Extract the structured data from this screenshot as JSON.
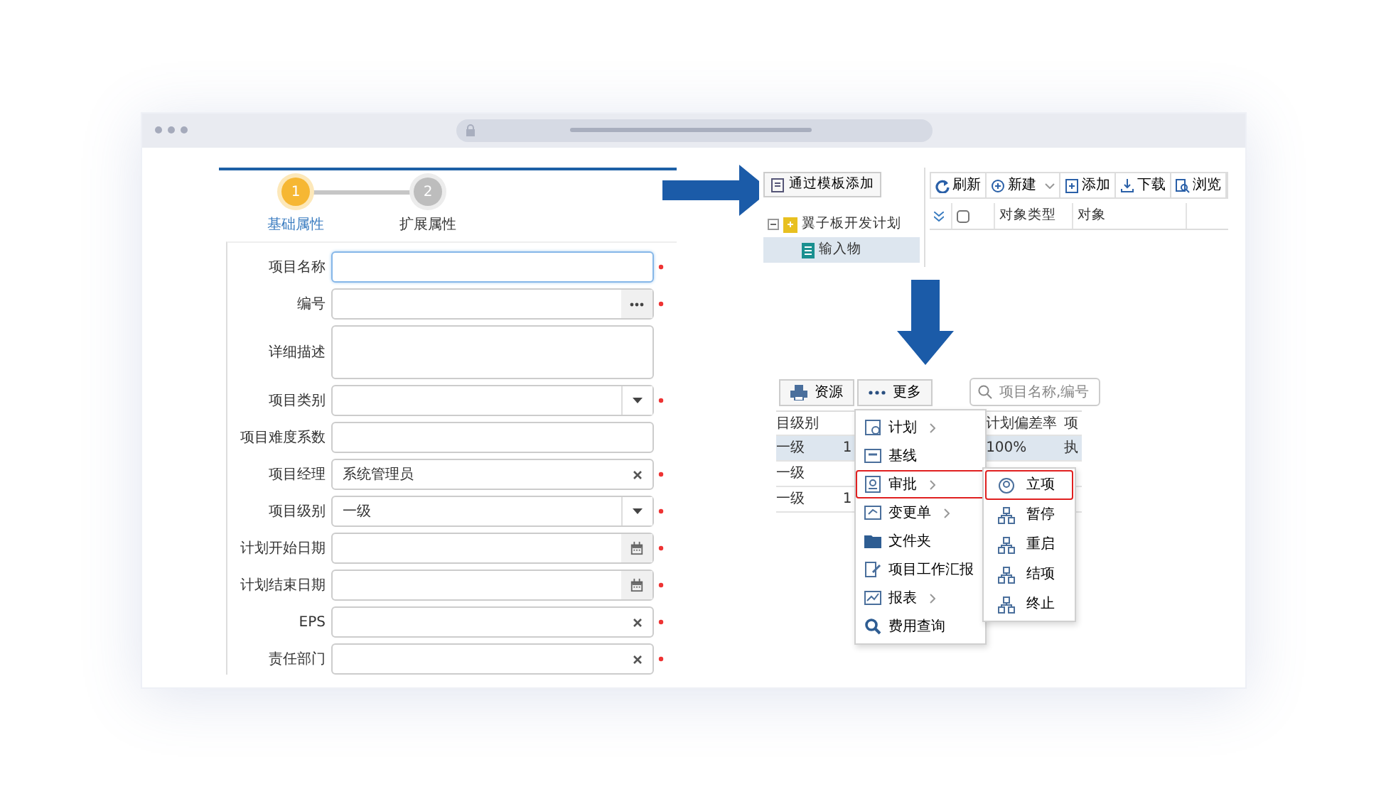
{
  "form_panel": {
    "steps": [
      {
        "number": "1",
        "label": "基础属性",
        "selected": true
      },
      {
        "number": "2",
        "label": "扩展属性",
        "selected": false
      }
    ],
    "fields": [
      {
        "label": "项目名称",
        "kind": "text",
        "required": true,
        "focused": true
      },
      {
        "label": "编号",
        "kind": "picker",
        "required": true,
        "focused": false
      },
      {
        "label": "详细描述",
        "kind": "textarea",
        "required": false,
        "focused": false
      },
      {
        "label": "项目类别",
        "kind": "select",
        "required": true,
        "focused": false
      },
      {
        "label": "项目难度系数",
        "kind": "text",
        "required": false,
        "focused": false
      },
      {
        "label": "项目经理",
        "kind": "clear",
        "value": "系统管理员",
        "required": true,
        "focused": false
      },
      {
        "label": "项目级别",
        "kind": "select",
        "value": "一级",
        "required": true,
        "focused": false
      },
      {
        "label": "计划开始日期",
        "kind": "date",
        "required": true,
        "focused": false
      },
      {
        "label": "计划结束日期",
        "kind": "date",
        "required": true,
        "focused": false
      },
      {
        "label": "EPS",
        "kind": "clear",
        "required": true,
        "focused": false
      },
      {
        "label": "责任部门",
        "kind": "clear",
        "required": true,
        "focused": false
      }
    ]
  },
  "template_panel": {
    "add_button": "通过模板添加",
    "tree": [
      {
        "label": "翼子板开发计划",
        "expanded": true,
        "selected": false,
        "children": [
          {
            "label": "输入物",
            "selected": true
          }
        ]
      }
    ],
    "toolbar": [
      {
        "label": "刷新",
        "kind": "refresh",
        "dropdown": false
      },
      {
        "label": "新建",
        "kind": "new",
        "dropdown": true
      },
      {
        "label": "添加",
        "kind": "add",
        "dropdown": false
      },
      {
        "label": "下载",
        "kind": "download",
        "dropdown": false
      },
      {
        "label": "浏览",
        "kind": "browse",
        "dropdown": false
      }
    ],
    "select_all_checked": false,
    "columns": [
      "对象类型",
      "对象"
    ]
  },
  "project_panel": {
    "toolbar": [
      {
        "label": "资源",
        "kind": "resource"
      },
      {
        "label": "更多",
        "kind": "more"
      }
    ],
    "search": {
      "placeholder": "项目名称,编号"
    },
    "columns": [
      "目级别",
      "",
      "计划偏差率",
      "项"
    ],
    "rows": [
      {
        "cells": [
          "一级",
          "1",
          "100%",
          "执"
        ],
        "selected": true
      },
      {
        "cells": [
          "一级",
          "",
          "",
          ""
        ],
        "selected": false
      },
      {
        "cells": [
          "一级",
          "1",
          "",
          ""
        ],
        "selected": false
      }
    ],
    "menu": [
      {
        "label": "计划",
        "kind": "plan",
        "submenu": true,
        "highlighted": false
      },
      {
        "label": "基线",
        "kind": "baseline",
        "submenu": false,
        "highlighted": false
      },
      {
        "label": "审批",
        "kind": "approve",
        "submenu": true,
        "highlighted": true
      },
      {
        "label": "变更单",
        "kind": "change",
        "submenu": true,
        "highlighted": false
      },
      {
        "label": "文件夹",
        "kind": "folder",
        "submenu": false,
        "highlighted": false
      },
      {
        "label": "项目工作汇报",
        "kind": "report",
        "submenu": false,
        "highlighted": false
      },
      {
        "label": "报表",
        "kind": "chart",
        "submenu": true,
        "highlighted": false
      },
      {
        "label": "费用查询",
        "kind": "search",
        "submenu": false,
        "highlighted": false
      }
    ],
    "submenu": [
      {
        "label": "立项",
        "kind": "start",
        "highlighted": true
      },
      {
        "label": "暂停",
        "kind": "flow",
        "highlighted": false
      },
      {
        "label": "重启",
        "kind": "flow",
        "highlighted": false
      },
      {
        "label": "结项",
        "kind": "flow",
        "highlighted": false
      },
      {
        "label": "终止",
        "kind": "flow",
        "highlighted": false
      }
    ]
  }
}
